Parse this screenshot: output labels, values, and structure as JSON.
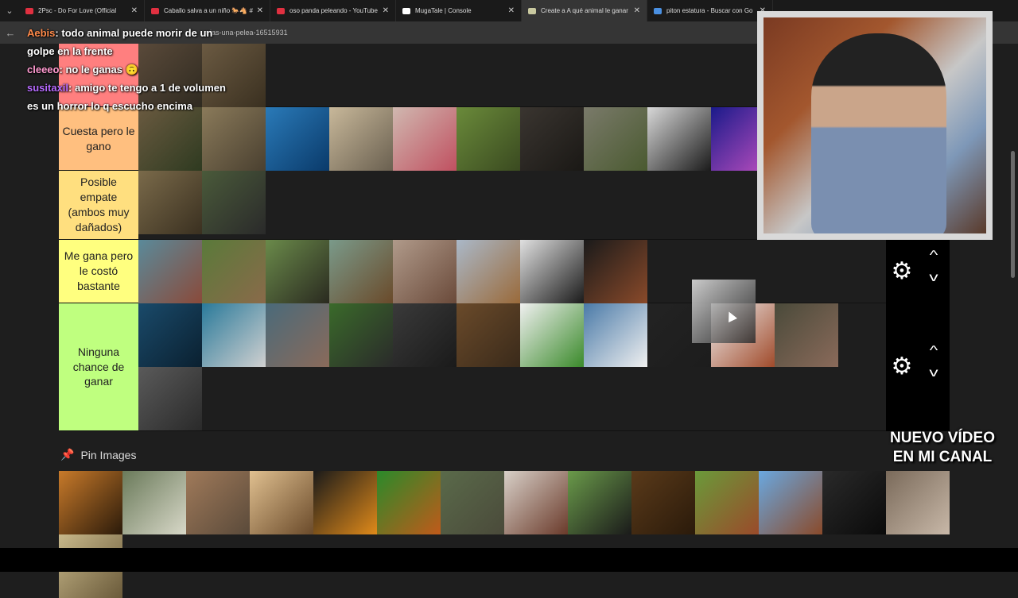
{
  "tabs": [
    {
      "title": "2Psc - Do For Love (Official",
      "active": false,
      "color": "#e03040"
    },
    {
      "title": "Caballo salva a un niño 🐎🐴 #",
      "active": false,
      "color": "#e03040"
    },
    {
      "title": "oso panda peleando - YouTube",
      "active": false,
      "color": "#e03040"
    },
    {
      "title": "MugaTale | Console",
      "active": false,
      "color": "#ffffff"
    },
    {
      "title": "Create a A qué animal le ganar",
      "active": true,
      "color": "#c9c9a0"
    },
    {
      "title": "piton estatura - Buscar con Go",
      "active": false,
      "color": "#4a90e2"
    }
  ],
  "address": {
    "url": "arias-una-pelea-16515931"
  },
  "chat": [
    {
      "user": "Aebis",
      "text": "todo animal puede morir de un golpe en la frente"
    },
    {
      "user": "cleeeo",
      "text": "no le ganas 🙃"
    },
    {
      "user": "susitaxil",
      "text": "amigo te tengo a 1 de volumen es un horror lo q escucho encima"
    }
  ],
  "tiers": [
    {
      "label": "",
      "color": "#ff7f7f",
      "items": [
        {
          "name": "owl-image",
          "c1": "#5a4a3a",
          "c2": "#2f2a20"
        },
        {
          "name": "owl2-image",
          "c1": "#6b5a42",
          "c2": "#3a3020"
        }
      ]
    },
    {
      "label": "Cuesta pero le gano",
      "color": "#ffbf7f",
      "items": [
        {
          "name": "sloth-image",
          "c1": "#6a5a40",
          "c2": "#2e3a20"
        },
        {
          "name": "hyena-image",
          "c1": "#8a7a5a",
          "c2": "#4a4030"
        },
        {
          "name": "dolphin-image",
          "c1": "#2a7ab8",
          "c2": "#0a3a6a"
        },
        {
          "name": "ostrich-image",
          "c1": "#c8b89a",
          "c2": "#6a6050"
        },
        {
          "name": "flamingo-image",
          "c1": "#d0b8b0",
          "c2": "#c05060"
        },
        {
          "name": "tortoise-image",
          "c1": "#6a8a3a",
          "c2": "#3a4a20"
        },
        {
          "name": "log-image",
          "c1": "#3a3530",
          "c2": "#1a1815"
        },
        {
          "name": "wombat-image",
          "c1": "#7a7a6a",
          "c2": "#4a5a30"
        },
        {
          "name": "crow-image",
          "c1": "#d8d8d8",
          "c2": "#1a1a1a"
        },
        {
          "name": "octopus-image",
          "c1": "#1a1a8a",
          "c2": "#c050c0"
        }
      ]
    },
    {
      "label": "Posible empate (ambos muy dañados)",
      "color": "#ffdf7f",
      "items": [
        {
          "name": "python-image",
          "c1": "#7a6a4a",
          "c2": "#3a3020"
        },
        {
          "name": "anteater-image",
          "c1": "#4a5a3a",
          "c2": "#2a2a2a"
        }
      ]
    },
    {
      "label": "Me gana pero le costó bastante",
      "color": "#ffff7f",
      "items": [
        {
          "name": "walrus-image",
          "c1": "#5a8a9a",
          "c2": "#8a4a3a"
        },
        {
          "name": "kangaroo-image",
          "c1": "#5a7a3a",
          "c2": "#8a6a4a"
        },
        {
          "name": "buffalo-image",
          "c1": "#6a8a4a",
          "c2": "#2a2a20"
        },
        {
          "name": "deer-image",
          "c1": "#7a9a8a",
          "c2": "#6a4a2a"
        },
        {
          "name": "pitbull-image",
          "c1": "#b09a8a",
          "c2": "#6a4a3a"
        },
        {
          "name": "giraffe-image",
          "c1": "#aab8c8",
          "c2": "#9a6a3a"
        },
        {
          "name": "zebra-image",
          "c1": "#e0e0e0",
          "c2": "#1a1a1a"
        },
        {
          "name": "horse-image",
          "c1": "#1a1a1a",
          "c2": "#8a4a2a"
        }
      ]
    },
    {
      "label": "Ninguna chance de ganar",
      "color": "#bfff7f",
      "items": [
        {
          "name": "whale-image",
          "c1": "#1a4a6a",
          "c2": "#0a2030"
        },
        {
          "name": "shark-image",
          "c1": "#2a7a9a",
          "c2": "#d0d0d0"
        },
        {
          "name": "elephant-image",
          "c1": "#4a6a7a",
          "c2": "#8a6a5a"
        },
        {
          "name": "gorilla-image",
          "c1": "#3a6a2a",
          "c2": "#2a2a2a"
        },
        {
          "name": "wolf-image",
          "c1": "#3a3a3a",
          "c2": "#1a1a1a"
        },
        {
          "name": "bear-image",
          "c1": "#6a4a2a",
          "c2": "#3a2a1a"
        },
        {
          "name": "panda-image",
          "c1": "#f0f0f0",
          "c2": "#3a8a2a"
        },
        {
          "name": "polarbear-image",
          "c1": "#4a7aa8",
          "c2": "#f0f0f0"
        },
        {
          "name": "eagle-ghost-image",
          "c1": "#2a2a2a",
          "c2": "#1a1a1a"
        },
        {
          "name": "orangutan-image",
          "c1": "#f0f0f0",
          "c2": "#a04a2a"
        },
        {
          "name": "hippo-image",
          "c1": "#4a4a3a",
          "c2": "#8a6a5a"
        },
        {
          "name": "rhino-image",
          "c1": "#5a5a5a",
          "c2": "#2a2a2a"
        }
      ]
    }
  ],
  "pin": {
    "label": "Pin Images"
  },
  "pool": [
    {
      "name": "tiger-image",
      "c1": "#c87a2a",
      "c2": "#2a1a0a"
    },
    {
      "name": "crocodile-image",
      "c1": "#6a7a5a",
      "c2": "#d8d8c8"
    },
    {
      "name": "lions-image",
      "c1": "#a07a5a",
      "c2": "#5a4a3a"
    },
    {
      "name": "porcupine-image",
      "c1": "#e0c090",
      "c2": "#6a4a2a"
    },
    {
      "name": "toucan-image",
      "c1": "#1a1a1a",
      "c2": "#e08a1a"
    },
    {
      "name": "frog-image",
      "c1": "#2a8a2a",
      "c2": "#c05a1a"
    },
    {
      "name": "komodo-image",
      "c1": "#5a6a4a",
      "c2": "#4a4a3a"
    },
    {
      "name": "tarantula-image",
      "c1": "#d8d0c8",
      "c2": "#6a3a2a"
    },
    {
      "name": "lapwing-image",
      "c1": "#6a9a4a",
      "c2": "#1a1a1a"
    },
    {
      "name": "lion-image",
      "c1": "#5a3a1a",
      "c2": "#2a1a0a"
    },
    {
      "name": "bull-image",
      "c1": "#6a9a3a",
      "c2": "#9a4a2a"
    },
    {
      "name": "bat-image",
      "c1": "#6aa8e0",
      "c2": "#8a4a2a"
    },
    {
      "name": "panther-image",
      "c1": "#2a2a2a",
      "c2": "#0a0a0a"
    },
    {
      "name": "cougar-image",
      "c1": "#7a6a5a",
      "c2": "#c8b8a8"
    },
    {
      "name": "extra-image",
      "c1": "#c8b88a",
      "c2": "#6a5a3a"
    }
  ],
  "promo": {
    "line1": "NUEVO VÍDEO",
    "line2": "EN MI CANAL"
  }
}
